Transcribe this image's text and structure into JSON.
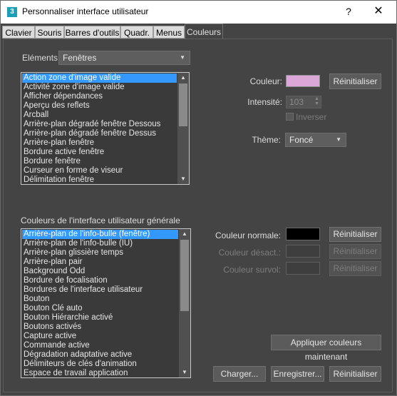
{
  "window": {
    "icon_glyph": "3",
    "title": "Personnaliser interface utilisateur",
    "help_glyph": "?",
    "close_glyph": "✕"
  },
  "tabs": [
    {
      "label": "Clavier"
    },
    {
      "label": "Souris"
    },
    {
      "label": "Barres d'outils"
    },
    {
      "label": "Quadr."
    },
    {
      "label": "Menus"
    },
    {
      "label": "Couleurs",
      "active": true
    }
  ],
  "elements": {
    "label": "Eléments:",
    "selected": "Fenêtres"
  },
  "items_list": [
    "Action zone d'image valide",
    "Activité zone d'image valide",
    "Afficher dépendances",
    "Aperçu des reflets",
    "Arcball",
    "Arrière-plan dégradé fenêtre Dessous",
    "Arrière-plan dégradé fenêtre Dessus",
    "Arrière-plan fenêtre",
    "Bordure active fenêtre",
    "Bordure fenêtre",
    "Curseur en forme de viseur",
    "Délimitation fenêtre"
  ],
  "color_settings": {
    "color_label": "Couleur:",
    "color_value": "#dba6d8",
    "reset_label": "Réinitialiser",
    "intensity_label": "Intensité:",
    "intensity_value": "103",
    "invert_label": "Inverser",
    "theme_label": "Thème:",
    "theme_value": "Foncé"
  },
  "general": {
    "section_label": "Couleurs de l'interface utilisateur générale",
    "items": [
      "Arrière-plan de l'info-bulle (fenêtre)",
      "Arrière-plan de l'info-bulle (IU)",
      "Arrière-plan glissière temps",
      "Arrière-plan pair",
      "Background Odd",
      "Bordure de focalisation",
      "Bordures de l'interface utilisateur",
      "Bouton",
      "Bouton Clé auto",
      "Bouton Hiérarchie activé",
      "Boutons activés",
      "Capture active",
      "Commande active",
      "Dégradation adaptative active",
      "Délimiteurs de clés d'animation",
      "Espace de travail application"
    ],
    "normal_label": "Couleur normale:",
    "normal_color": "#000000",
    "disabled_label": "Couleur désact.:",
    "hover_label": "Couleur survol:",
    "reset_label": "Réinitialiser"
  },
  "buttons": {
    "apply_now": "Appliquer couleurs maintenant",
    "load": "Charger...",
    "save": "Enregistrer...",
    "reset": "Réinitialiser"
  },
  "icons": {
    "dropdown": "▼",
    "scroll_up": "▲",
    "scroll_down": "▼",
    "spin": "▲▼"
  }
}
